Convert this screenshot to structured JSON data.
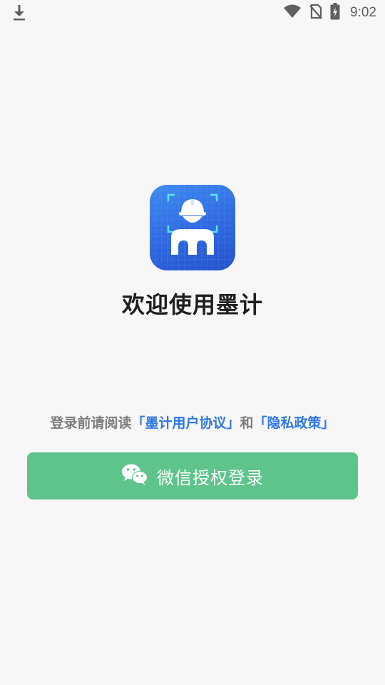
{
  "status_bar": {
    "time": "9:02",
    "icons": [
      "download-icon",
      "wifi-icon",
      "no-sim-icon",
      "battery-charging-icon"
    ]
  },
  "app": {
    "icon_name": "app-logo-worker-helmet",
    "welcome_title": "欢迎使用墨计"
  },
  "agreement": {
    "prefix": "登录前请阅读",
    "user_agreement": "「墨计用户协议」",
    "conjunction": "和",
    "privacy_policy": "「隐私政策」"
  },
  "login": {
    "wechat_button_label": "微信授权登录",
    "icon_name": "wechat-icon"
  },
  "colors": {
    "background": "#f7f7f7",
    "link_blue": "#2f78e2",
    "wechat_green": "#5ec48c",
    "title_text": "#1f1f1f",
    "muted_text": "#7c7c7c"
  }
}
